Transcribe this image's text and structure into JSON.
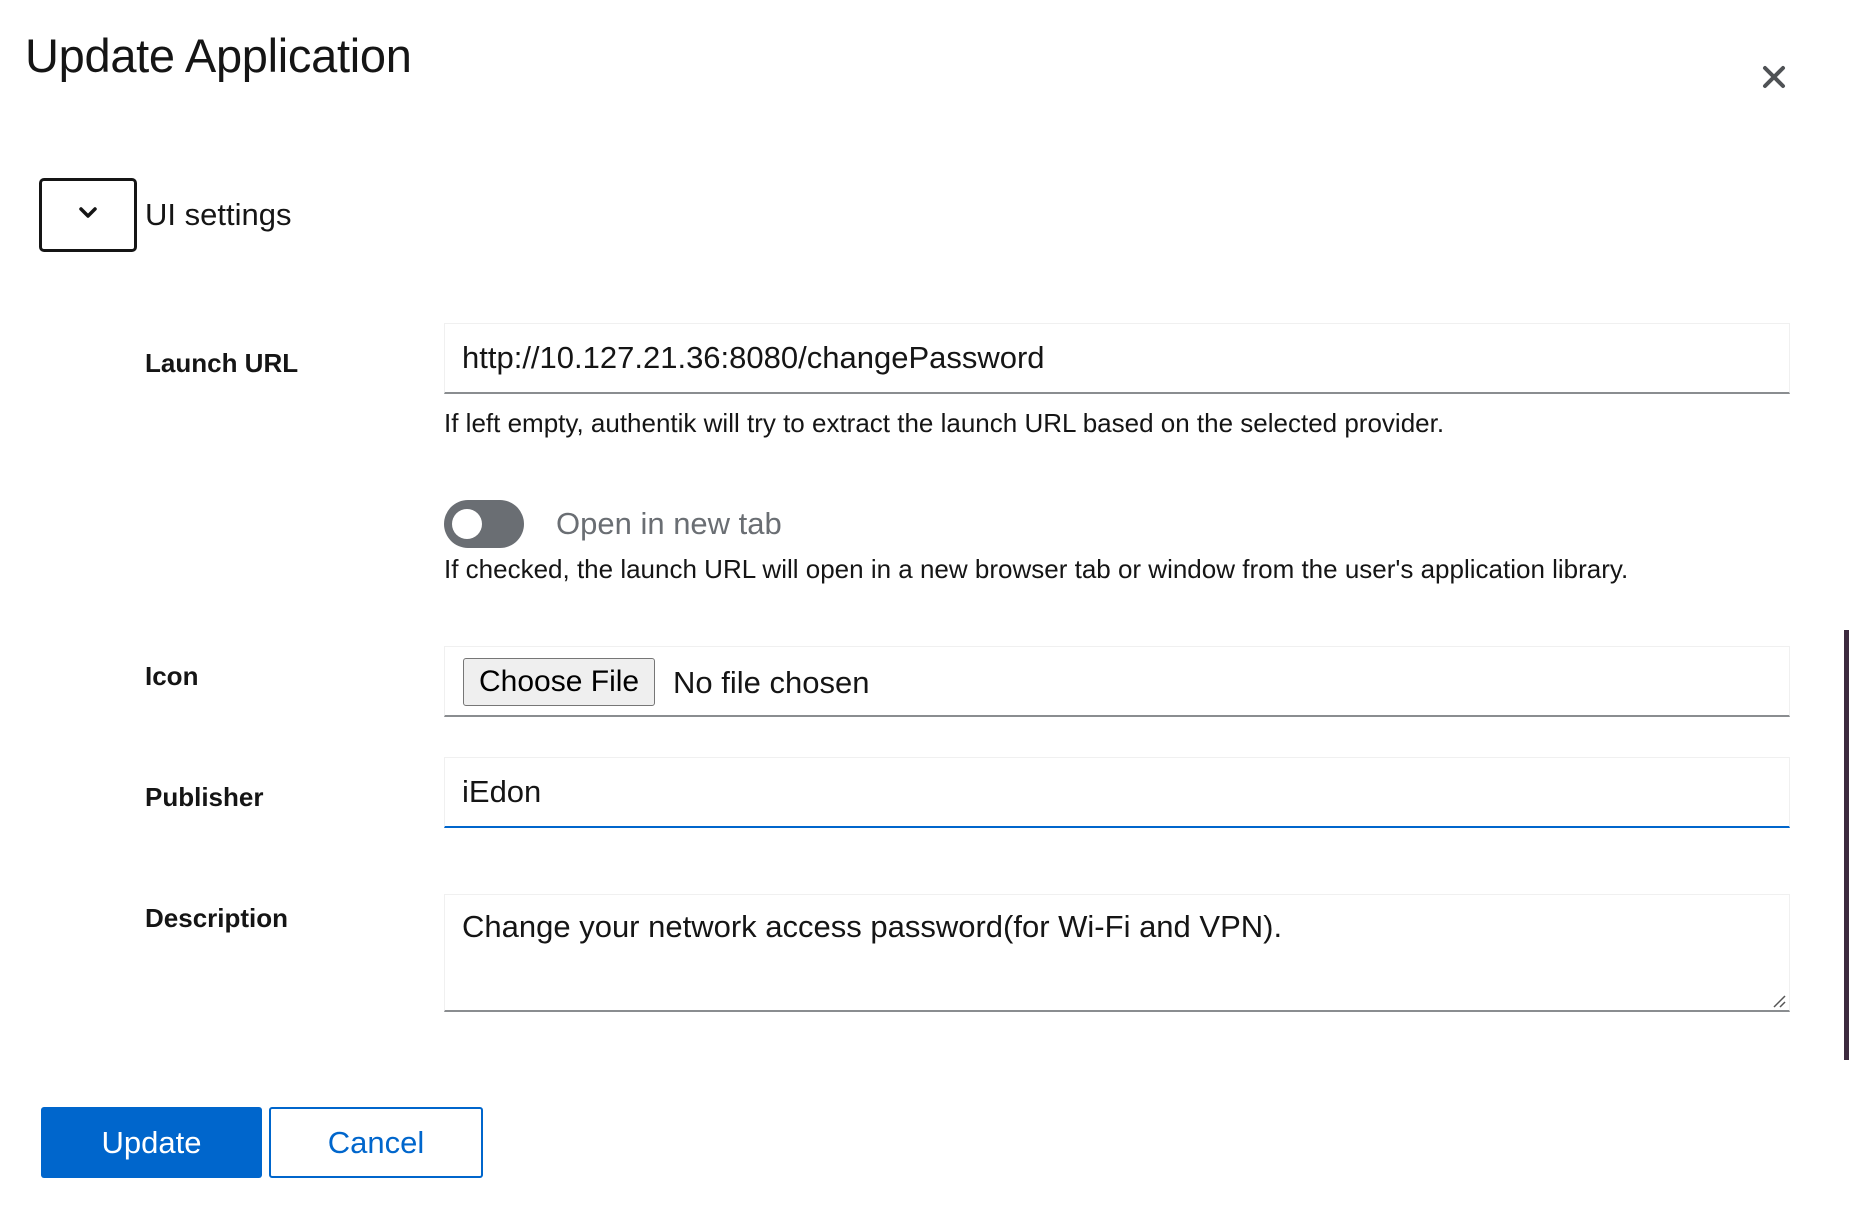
{
  "dialog": {
    "title": "Update Application",
    "close_icon": "close-icon"
  },
  "section": {
    "toggle_icon": "chevron-down-icon",
    "label": "UI settings"
  },
  "launch_url": {
    "label": "Launch URL",
    "value": "http://10.127.21.36:8080/changePassword",
    "helper": "If left empty, authentik will try to extract the launch URL based on the selected provider."
  },
  "open_in_new_tab": {
    "label": "Open in new tab",
    "checked": false,
    "helper": "If checked, the launch URL will open in a new browser tab or window from the user's application library."
  },
  "icon": {
    "label": "Icon",
    "button_label": "Choose File",
    "status": "No file chosen"
  },
  "publisher": {
    "label": "Publisher",
    "value": "iEdon"
  },
  "description": {
    "label": "Description",
    "value": "Change your network access password(for Wi-Fi and VPN)."
  },
  "actions": {
    "update_label": "Update",
    "cancel_label": "Cancel"
  },
  "colors": {
    "primary": "#0066cc",
    "text": "#151515",
    "muted": "#6a6e73",
    "border": "#8a8d90"
  }
}
